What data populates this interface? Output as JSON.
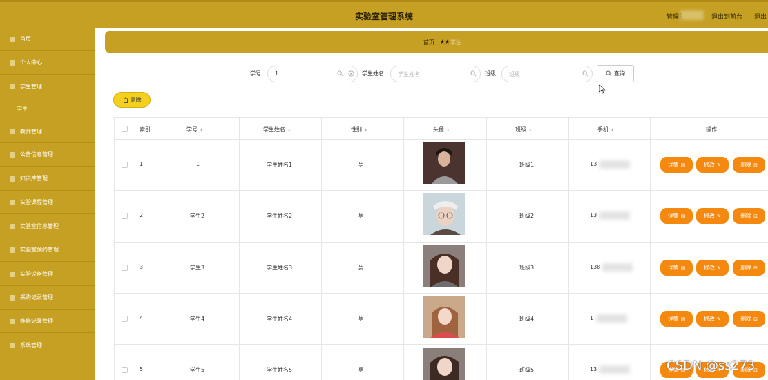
{
  "header": {
    "title": "实验室管理系统",
    "admin_label": "管理员",
    "front_link": "退出到前台",
    "logout_link": "退出"
  },
  "sidebar": {
    "items": [
      {
        "label": "首页",
        "icon": "home-icon"
      },
      {
        "label": "个人中心",
        "icon": "user-icon"
      },
      {
        "label": "学生管理",
        "icon": "user-icon"
      },
      {
        "label": "教师管理",
        "icon": "user-icon"
      },
      {
        "label": "公告信息管理",
        "icon": "doc-icon"
      },
      {
        "label": "知识库管理",
        "icon": "doc-icon"
      },
      {
        "label": "实验课程管理",
        "icon": "doc-icon"
      },
      {
        "label": "实验室信息管理",
        "icon": "chart-icon"
      },
      {
        "label": "实验室预约管理",
        "icon": "user-icon"
      },
      {
        "label": "实验设备管理",
        "icon": "doc-icon"
      },
      {
        "label": "采购记录管理",
        "icon": "globe-icon"
      },
      {
        "label": "维修记录管理",
        "icon": "user-icon"
      },
      {
        "label": "系统管理",
        "icon": "chat-icon"
      }
    ],
    "sub_item": "学生"
  },
  "breadcrumb": {
    "home": "首页",
    "separator": "★★",
    "current": "学生"
  },
  "search": {
    "fields": [
      {
        "label": "学号",
        "value": "1",
        "placeholder": ""
      },
      {
        "label": "学生姓名",
        "value": "",
        "placeholder": "学生姓名"
      },
      {
        "label": "班级",
        "value": "",
        "placeholder": "班级"
      }
    ],
    "query_button": "查询"
  },
  "toolbar": {
    "delete_button": "删除"
  },
  "table": {
    "columns": [
      "索引",
      "学号",
      "学生姓名",
      "性别",
      "头像",
      "班级",
      "手机",
      "操作"
    ],
    "rows": [
      {
        "index": "1",
        "student_no": "1",
        "name": "学生姓名1",
        "gender": "男",
        "class": "班级1",
        "phone": "13"
      },
      {
        "index": "2",
        "student_no": "学生2",
        "name": "学生姓名2",
        "gender": "男",
        "class": "班级2",
        "phone": "13"
      },
      {
        "index": "3",
        "student_no": "学生3",
        "name": "学生姓名3",
        "gender": "男",
        "class": "班级3",
        "phone": "138"
      },
      {
        "index": "4",
        "student_no": "学生4",
        "name": "学生姓名4",
        "gender": "男",
        "class": "班级4",
        "phone": "1"
      },
      {
        "index": "5",
        "student_no": "学生5",
        "name": "学生姓名5",
        "gender": "男",
        "class": "班级5",
        "phone": "13"
      }
    ],
    "actions": {
      "detail": "详情",
      "edit": "修改",
      "delete": "删除"
    }
  },
  "watermark": "CSDN @ss273"
}
